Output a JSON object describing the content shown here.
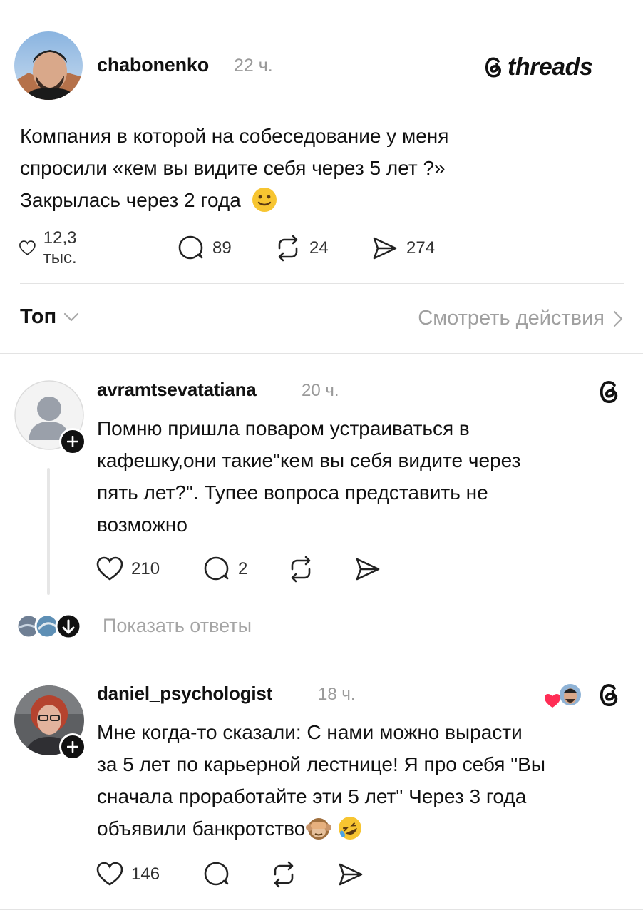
{
  "post": {
    "author": "chabonenko",
    "time": "22 ч.",
    "brand": "threads",
    "text_lines": [
      "Компания в которой на собеседование у меня",
      "спросили «кем вы видите себя через 5 лет ?»",
      "Закрылась через 2 года"
    ],
    "metrics": {
      "likes": "12,3 тыс.",
      "comments": "89",
      "reposts": "24",
      "shares": "274"
    }
  },
  "sort": {
    "label": "Топ",
    "activity_label": "Смотреть действия"
  },
  "replies": [
    {
      "author": "avramtsevatatiana",
      "time": "20 ч.",
      "text_lines": [
        "Помню пришла поваром устраиваться в",
        "кафешку,они такие\"кем вы себя видите через",
        "пять лет?\". Тупее вопроса представить не",
        "возможно"
      ],
      "likes": "210",
      "comments": "2",
      "show_replies": "Показать ответы"
    },
    {
      "author": "daniel_psychologist",
      "time": "18 ч.",
      "text_lines": [
        "Мне когда-то сказали: С нами можно вырасти",
        "за 5 лет по карьерной лестнице! Я про себя \"Вы",
        "сначала проработайте эти 5 лет\" Через 3 года",
        "объявили банкротство"
      ],
      "likes": "146"
    }
  ],
  "colors": {
    "text": "#111111",
    "muted": "#9a9a9a",
    "divider": "#e3e3e3",
    "heart_red": "#ff2d55"
  }
}
